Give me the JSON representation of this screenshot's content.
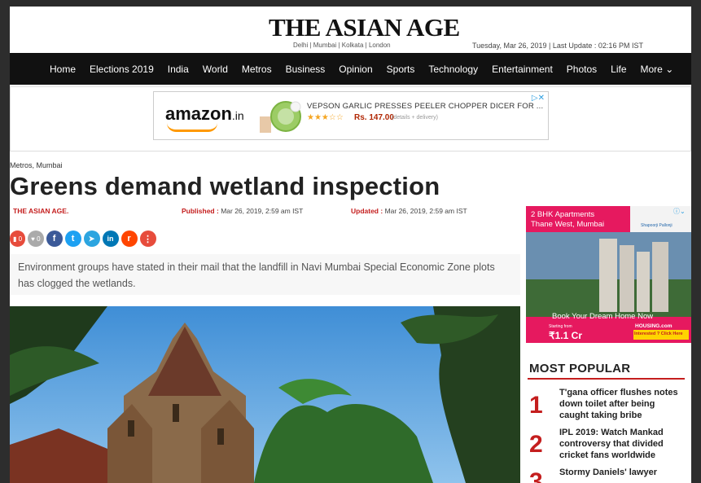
{
  "masthead": {
    "logo": "THE ASIAN AGE",
    "editions": "Delhi | Mumbai | Kolkata | London",
    "dateline": "Tuesday, Mar 26, 2019 | Last Update : 02:16 PM IST"
  },
  "nav": {
    "items": [
      "Home",
      "Elections 2019",
      "India",
      "World",
      "Metros",
      "Business",
      "Opinion",
      "Sports",
      "Technology",
      "Entertainment",
      "Photos",
      "Life",
      "More ⌄"
    ]
  },
  "ad": {
    "brand": "amazon",
    "tld": ".in",
    "product_title": "VEPSON GARLIC PRESSES PEELER CHOPPER DICER FOR ...",
    "price": "Rs. 147.00",
    "delivery": "(details + delivery)",
    "rating_stars": 3.5,
    "choices_icon": "adchoices-icon"
  },
  "article": {
    "category": "Metros, Mumbai",
    "headline": "Greens demand wetland inspection",
    "author": "THE ASIAN AGE.",
    "published_label": "Published :",
    "published": "Mar 26, 2019, 2:59 am IST",
    "updated_label": "Updated :",
    "updated": "Mar 26, 2019, 2:59 am IST",
    "comments_count": "0",
    "likes_count": "0",
    "summary": "Environment groups have stated in their mail that the landfill in Navi Mumbai Special Economic Zone plots has clogged the wetlands."
  },
  "social": [
    {
      "name": "facebook-icon",
      "glyph": "f",
      "color": "#3b5998"
    },
    {
      "name": "twitter-icon",
      "glyph": "t",
      "color": "#1da1f2"
    },
    {
      "name": "telegram-icon",
      "glyph": "➤",
      "color": "#2ca5e0"
    },
    {
      "name": "linkedin-icon",
      "glyph": "in",
      "color": "#0077b5"
    },
    {
      "name": "reddit-icon",
      "glyph": "r",
      "color": "#ff4500"
    },
    {
      "name": "more-share-icon",
      "glyph": "⋮",
      "color": "#e74c3c"
    }
  ],
  "right_ad": {
    "headline_line1": "2 BHK Apartments",
    "headline_line2": "Thane West, Mumbai",
    "brand": "Shapoorji Pallonji",
    "cta": "Book Your Dream Home Now",
    "price_label": "Starting from",
    "price": "₹1.1 Cr",
    "partner": "HOUSING.com",
    "partner_cta": "Interested ? Click Here"
  },
  "most_popular": {
    "title": "MOST POPULAR",
    "items": [
      {
        "rank": "1",
        "text": "T'gana officer flushes notes down toilet after being caught taking bribe"
      },
      {
        "rank": "2",
        "text": "IPL 2019: Watch Mankad controversy that divided cricket fans worldwide"
      },
      {
        "rank": "3",
        "text": "Stormy Daniels' lawyer"
      }
    ]
  },
  "colors": {
    "accent": "#c41e1e",
    "nav_bg": "#111111",
    "pink": "#e6195f"
  }
}
